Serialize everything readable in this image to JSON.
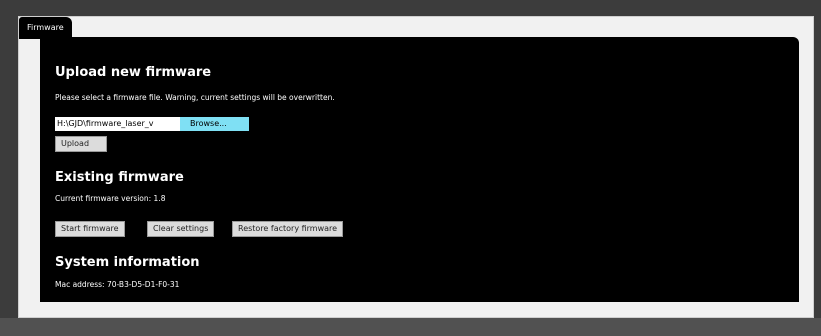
{
  "tab": {
    "label": "Firmware"
  },
  "upload": {
    "heading": "Upload new firmware",
    "description": "Please select a firmware file. Warning, current settings will be overwritten.",
    "file_value": "H:\\GJD\\firmware_laser_v",
    "browse_label": "Browse...",
    "upload_label": "Upload"
  },
  "existing": {
    "heading": "Existing firmware",
    "version_text": "Current firmware version: 1.8",
    "buttons": {
      "start": "Start firmware",
      "clear": "Clear settings",
      "restore": "Restore factory firmware"
    }
  },
  "system": {
    "heading": "System information",
    "mac_text": "Mac address: 70-B3-D5-D1-F0-31"
  },
  "colors": {
    "panel_bg": "#000000",
    "browse_bg": "#7fe0f4",
    "frame_bg": "#3c3c3c"
  }
}
